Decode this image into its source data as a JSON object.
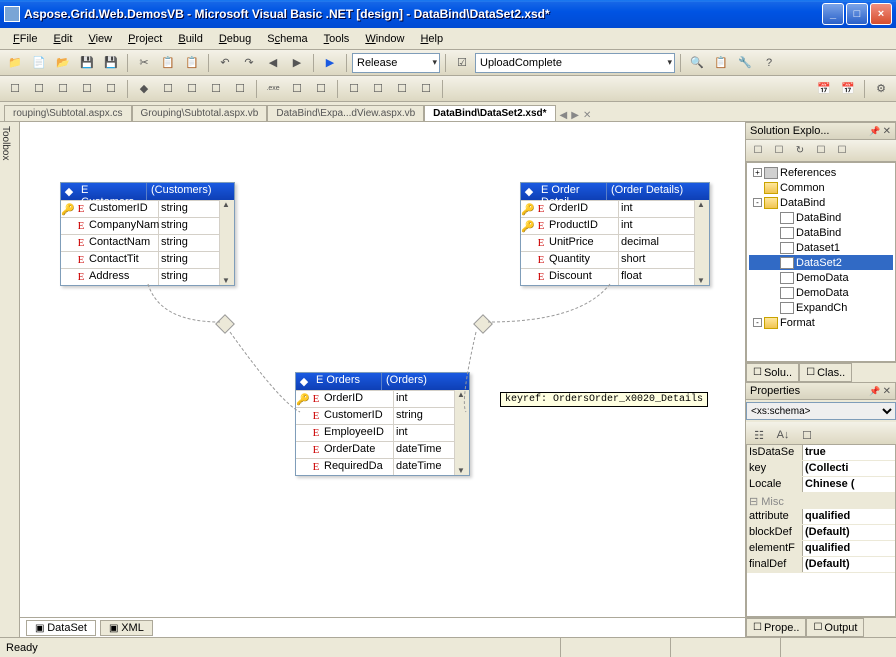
{
  "window": {
    "title": "Aspose.Grid.Web.DemosVB - Microsoft Visual Basic .NET [design] - DataBind\\DataSet2.xsd*"
  },
  "menu": [
    "File",
    "Edit",
    "View",
    "Project",
    "Build",
    "Debug",
    "Schema",
    "Tools",
    "Window",
    "Help"
  ],
  "toolbar1": {
    "config": "Release",
    "custom": "UploadComplete"
  },
  "tabs": {
    "items": [
      "rouping\\Subtotal.aspx.cs",
      "Grouping\\Subtotal.aspx.vb",
      "DataBind\\Expa...dView.aspx.vb",
      "DataBind\\DataSet2.xsd*"
    ],
    "active_index": 3
  },
  "bottom_tabs": {
    "dataset": "DataSet",
    "xml": "XML"
  },
  "tables": {
    "customers": {
      "name": "Customers",
      "paren": "(Customers)",
      "rows": [
        {
          "key": true,
          "name": "CustomerID",
          "type": "string"
        },
        {
          "key": false,
          "name": "CompanyNam",
          "type": "string"
        },
        {
          "key": false,
          "name": "ContactNam",
          "type": "string"
        },
        {
          "key": false,
          "name": "ContactTit",
          "type": "string"
        },
        {
          "key": false,
          "name": "Address",
          "type": "string"
        }
      ]
    },
    "order_details": {
      "name": "Order Detail",
      "paren": "(Order Details)",
      "rows": [
        {
          "key": true,
          "name": "OrderID",
          "type": "int"
        },
        {
          "key": true,
          "name": "ProductID",
          "type": "int"
        },
        {
          "key": false,
          "name": "UnitPrice",
          "type": "decimal"
        },
        {
          "key": false,
          "name": "Quantity",
          "type": "short"
        },
        {
          "key": false,
          "name": "Discount",
          "type": "float"
        }
      ]
    },
    "orders": {
      "name": "Orders",
      "paren": "(Orders)",
      "rows": [
        {
          "key": true,
          "name": "OrderID",
          "type": "int"
        },
        {
          "key": false,
          "name": "CustomerID",
          "type": "string"
        },
        {
          "key": false,
          "name": "EmployeeID",
          "type": "int"
        },
        {
          "key": false,
          "name": "OrderDate",
          "type": "dateTime"
        },
        {
          "key": false,
          "name": "RequiredDa",
          "type": "dateTime"
        }
      ]
    }
  },
  "tooltip": "keyref: OrdersOrder_x0020_Details",
  "solution": {
    "title": "Solution Explo...",
    "nodes": [
      {
        "indent": 0,
        "pm": "+",
        "ico": "ref",
        "label": "References"
      },
      {
        "indent": 0,
        "pm": "",
        "ico": "folder",
        "label": "Common"
      },
      {
        "indent": 0,
        "pm": "-",
        "ico": "folder",
        "label": "DataBind"
      },
      {
        "indent": 1,
        "pm": "",
        "ico": "file",
        "label": "DataBind"
      },
      {
        "indent": 1,
        "pm": "",
        "ico": "file",
        "label": "DataBind"
      },
      {
        "indent": 1,
        "pm": "",
        "ico": "file",
        "label": "Dataset1"
      },
      {
        "indent": 1,
        "pm": "",
        "ico": "file",
        "label": "DataSet2",
        "selected": true
      },
      {
        "indent": 1,
        "pm": "",
        "ico": "file",
        "label": "DemoData"
      },
      {
        "indent": 1,
        "pm": "",
        "ico": "file",
        "label": "DemoData"
      },
      {
        "indent": 1,
        "pm": "",
        "ico": "file",
        "label": "ExpandCh"
      },
      {
        "indent": 0,
        "pm": "-",
        "ico": "folder",
        "label": "Format"
      }
    ],
    "tabs": [
      "Solu..",
      "Clas.."
    ]
  },
  "properties": {
    "title": "Properties",
    "object": "<xs:schema>",
    "rows": [
      {
        "cat": false,
        "name": "IsDataSe",
        "value": "true"
      },
      {
        "cat": false,
        "name": "key",
        "value": "(Collecti"
      },
      {
        "cat": false,
        "name": "Locale",
        "value": "Chinese ("
      },
      {
        "cat": true,
        "name": "Misc",
        "value": ""
      },
      {
        "cat": false,
        "name": "attribute",
        "value": "qualified"
      },
      {
        "cat": false,
        "name": "blockDef",
        "value": "(Default)"
      },
      {
        "cat": false,
        "name": "elementF",
        "value": "qualified"
      },
      {
        "cat": false,
        "name": "finalDef",
        "value": "(Default)"
      }
    ],
    "tabs": [
      "Prope..",
      "Output"
    ]
  },
  "toolbox_label": "Toolbox",
  "status": "Ready"
}
